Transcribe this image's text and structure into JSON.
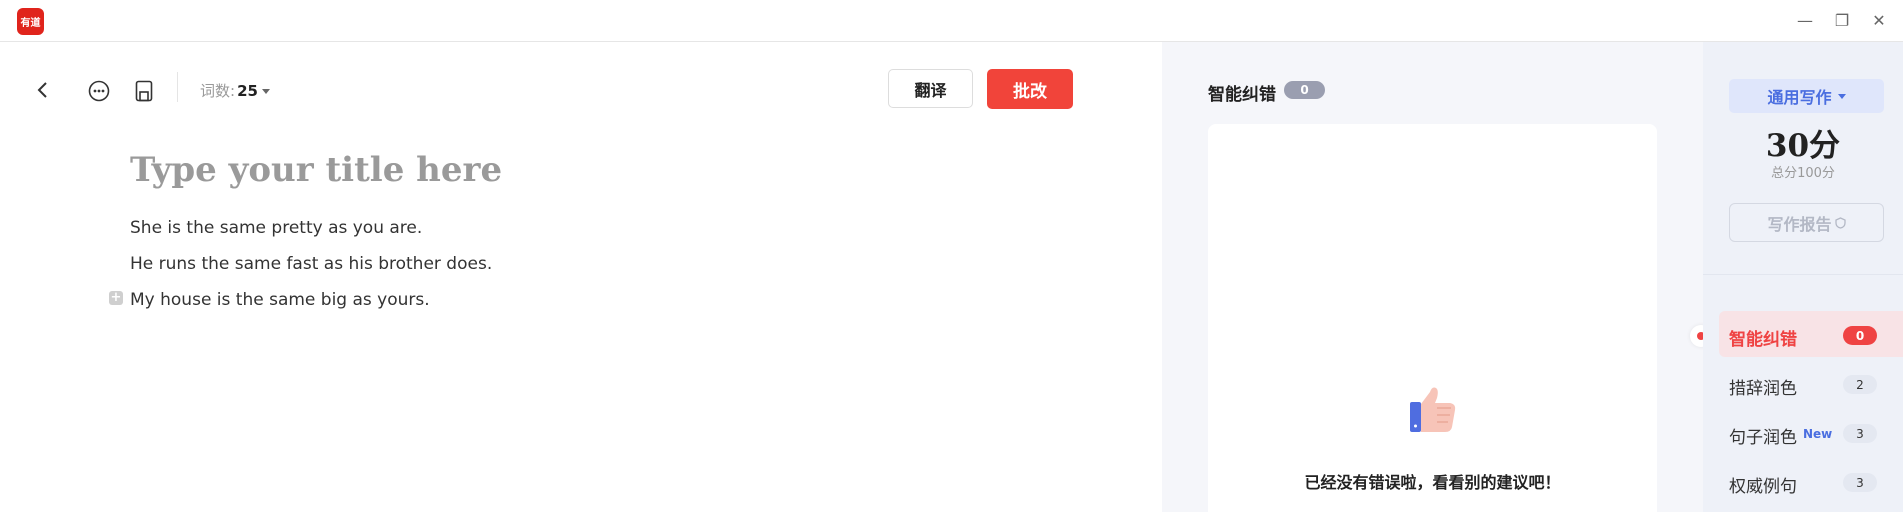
{
  "app": {
    "logo_text": "有道"
  },
  "window_controls": {
    "minimize": "—",
    "restore": "❐",
    "close": "✕"
  },
  "toolbar": {
    "word_count_label": "词数:",
    "word_count_value": "25",
    "translate_label": "翻译",
    "correct_label": "批改"
  },
  "document": {
    "title_placeholder": "Type your title here",
    "lines": [
      "She is the same pretty as you are.",
      "He runs the same fast as his brother does.",
      "My house is the same big as yours."
    ]
  },
  "panel": {
    "title": "智能纠错",
    "count": "0",
    "empty_message": "已经没有错误啦，看看别的建议吧！"
  },
  "sidebar": {
    "mode_label": "通用写作",
    "score": "30分",
    "total_label": "总分100分",
    "report_label": "写作报告",
    "items": [
      {
        "label": "智能纠错",
        "count": "0"
      },
      {
        "label": "措辞润色",
        "count": "2"
      },
      {
        "label": "句子润色",
        "tag": "New",
        "count": "3"
      },
      {
        "label": "权威例句",
        "count": "3"
      }
    ]
  },
  "colors": {
    "brand_red": "#e0241c",
    "accent_red": "#f1443a",
    "accent_blue": "#4a6ee0"
  }
}
